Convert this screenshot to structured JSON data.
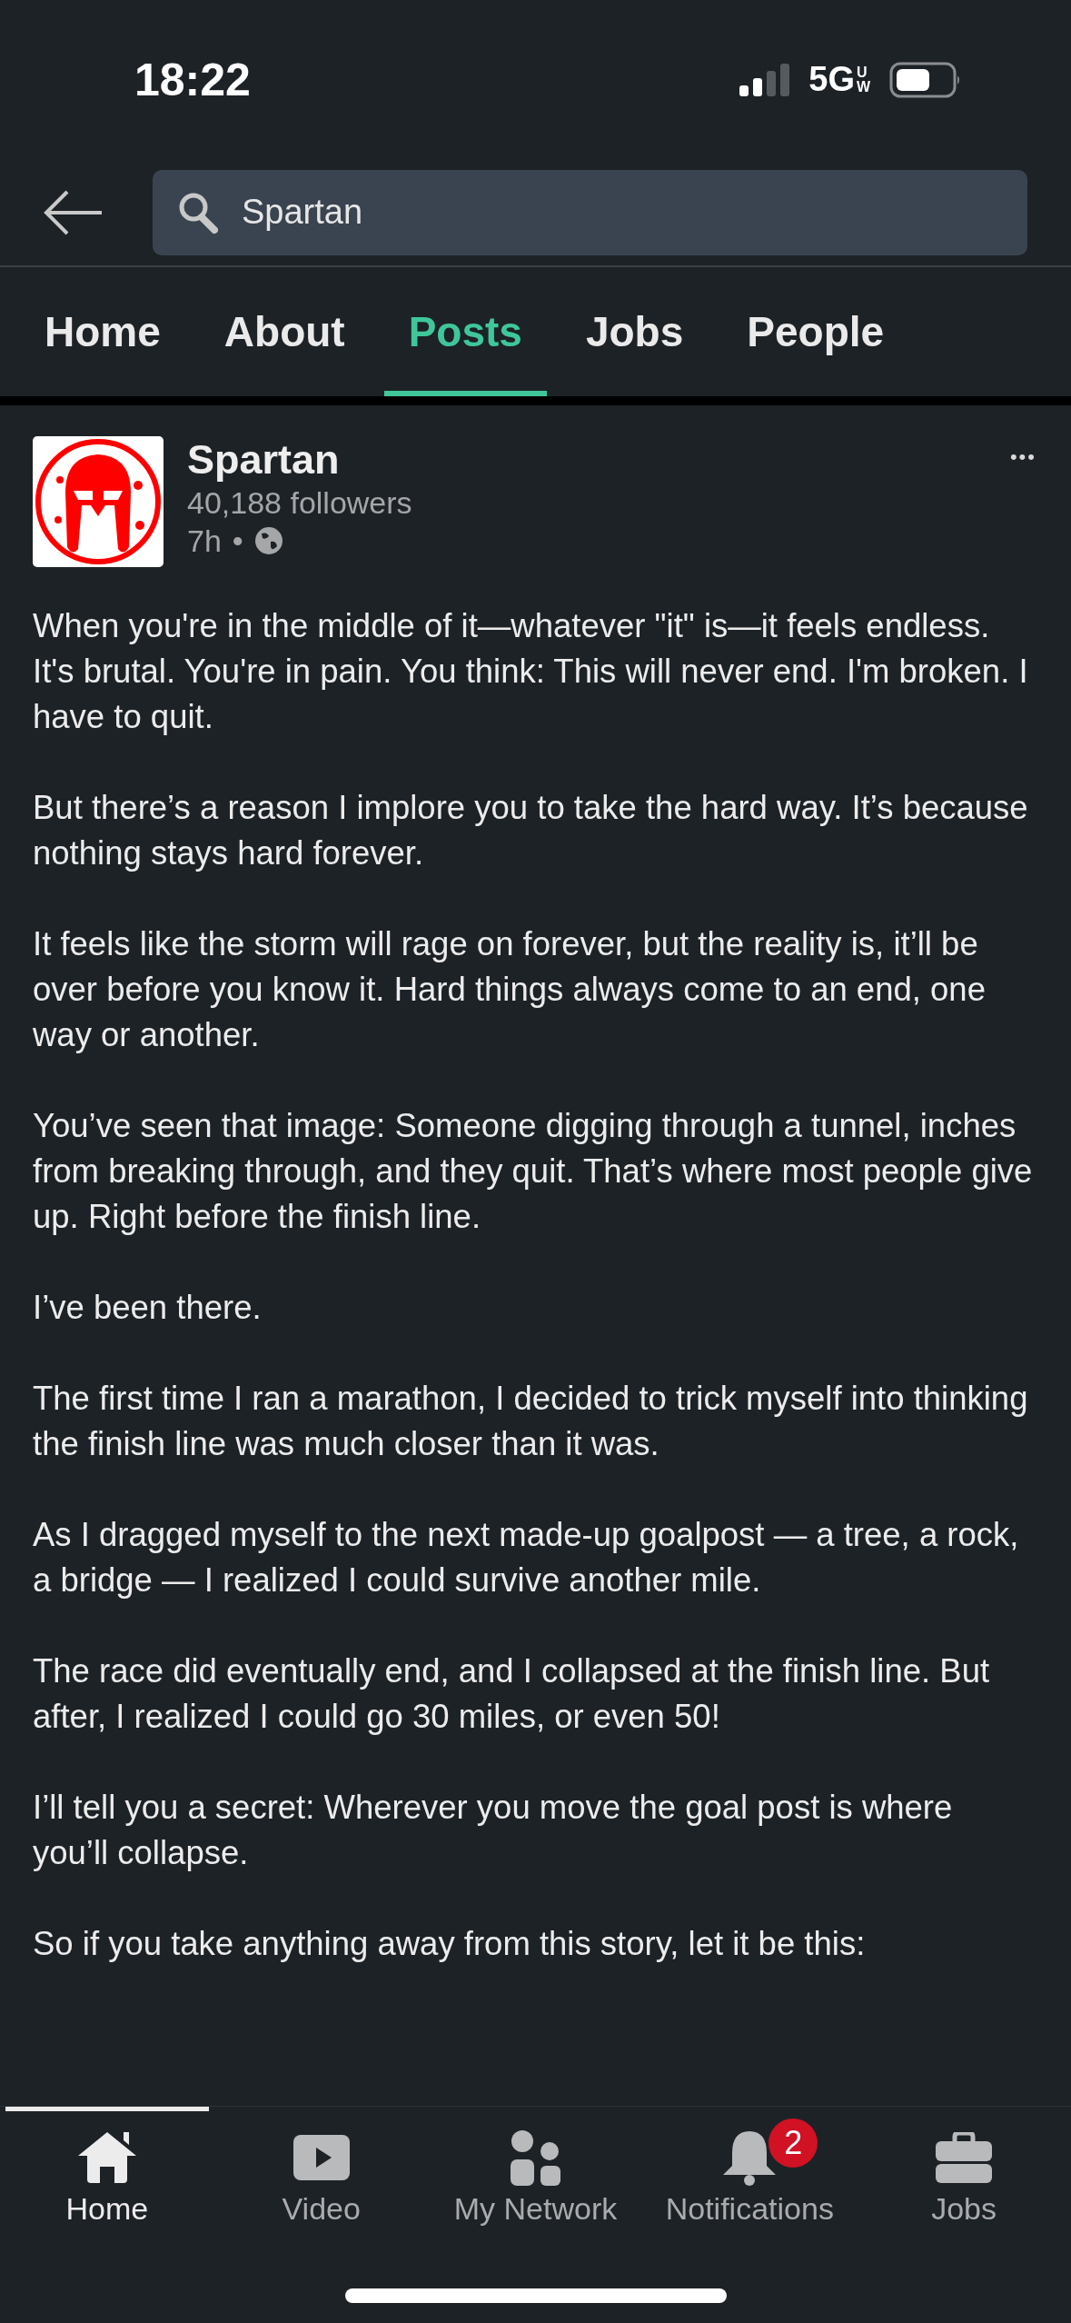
{
  "status_bar": {
    "time": "18:22",
    "network": "5G",
    "network_sub": "UW"
  },
  "search": {
    "value": "Spartan"
  },
  "tabs": [
    {
      "label": "Home",
      "selected": false
    },
    {
      "label": "About",
      "selected": false
    },
    {
      "label": "Posts",
      "selected": true
    },
    {
      "label": "Jobs",
      "selected": false
    },
    {
      "label": "People",
      "selected": false
    }
  ],
  "post": {
    "author": "Spartan",
    "followers": "40,188 followers",
    "time": "7h",
    "bullet": "•",
    "more": "•••",
    "paragraphs": [
      "When you're in the middle of it—whatever \"it\" is—it feels endless. It's brutal. You're in pain. You think: This will never end. I'm broken. I have to quit.",
      "But there’s a reason I implore you to take the hard way. It’s because nothing stays hard forever.",
      "It feels like the storm will rage on forever, but the reality is, it’ll be over before you know it. Hard things always come to an end, one way or another.",
      "You’ve seen that image: Someone digging through a tunnel, inches from breaking through, and they quit. That’s where most people give up. Right before the finish line.",
      "I’ve been there.",
      "The first time I ran a marathon, I decided to trick myself into thinking the finish line was much closer than it was.",
      "As I dragged myself to the next made-up goalpost — a tree, a rock, a bridge — I realized I could survive another mile.",
      "The race did eventually end, and I collapsed at the finish line. But after, I realized I could go 30 miles, or even 50!",
      "I’ll tell you a secret: Wherever you move the goal post is where you’ll collapse.",
      "So if you take anything away from this story, let it be this:"
    ]
  },
  "bottom_nav": [
    {
      "kind": "home",
      "label": "Home",
      "selected": true
    },
    {
      "kind": "video",
      "label": "Video",
      "selected": false
    },
    {
      "kind": "network",
      "label": "My Network",
      "selected": false
    },
    {
      "kind": "bell",
      "label": "Notifications",
      "selected": false,
      "badge": "2"
    },
    {
      "kind": "jobs",
      "label": "Jobs",
      "selected": false
    }
  ]
}
